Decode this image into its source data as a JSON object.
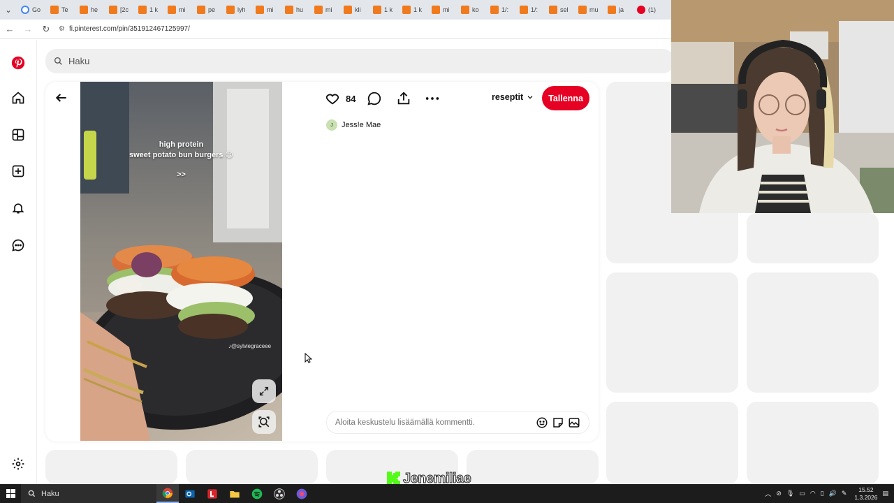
{
  "browser": {
    "tabs": [
      {
        "label": "Go",
        "icon": "google-icon"
      },
      {
        "label": "Te",
        "icon": "orange-app-icon"
      },
      {
        "label": "he",
        "icon": "orange-app-icon"
      },
      {
        "label": "[2c",
        "icon": "orange-app-icon"
      },
      {
        "label": "1 k",
        "icon": "orange-app-icon"
      },
      {
        "label": "mi",
        "icon": "orange-app-icon"
      },
      {
        "label": "pe",
        "icon": "orange-app-icon"
      },
      {
        "label": "lyh",
        "icon": "orange-app-icon"
      },
      {
        "label": "mi",
        "icon": "orange-app-icon"
      },
      {
        "label": "hu",
        "icon": "orange-app-icon"
      },
      {
        "label": "mi",
        "icon": "orange-app-icon"
      },
      {
        "label": "kli",
        "icon": "orange-app-icon"
      },
      {
        "label": "1 k",
        "icon": "orange-app-icon"
      },
      {
        "label": "1 k",
        "icon": "orange-app-icon"
      },
      {
        "label": "mi",
        "icon": "orange-app-icon"
      },
      {
        "label": "ko",
        "icon": "orange-app-icon"
      },
      {
        "label": "1/:",
        "icon": "orange-app-icon"
      },
      {
        "label": "1/:",
        "icon": "orange-app-icon"
      },
      {
        "label": "sel",
        "icon": "orange-app-icon"
      },
      {
        "label": "mu",
        "icon": "orange-app-icon"
      },
      {
        "label": "ja",
        "icon": "orange-app-icon"
      },
      {
        "label": "(1)",
        "icon": "pinterest-icon"
      }
    ],
    "url": "fi.pinterest.com/pin/351912467125997/"
  },
  "search": {
    "placeholder": "Haku"
  },
  "pin": {
    "overlay_line1": "high protein",
    "overlay_line2": "sweet potato bun burgers 😊",
    "overlay_arrows": ">>",
    "watermark": "@sylviegraceee",
    "likes": "84",
    "board": "reseptit",
    "save_label": "Tallenna",
    "author_name": "Jess!e Mae",
    "author_initial": "J",
    "comment_placeholder": "Aloita keskustelu lisäämällä kommentti."
  },
  "stream_watermark": "Jenemiliae",
  "taskbar": {
    "search_label": "Haku",
    "time": "15.52",
    "date": "1.3.2026"
  },
  "colors": {
    "pinterest_red": "#e60023",
    "placeholder": "#f1f1f1"
  }
}
